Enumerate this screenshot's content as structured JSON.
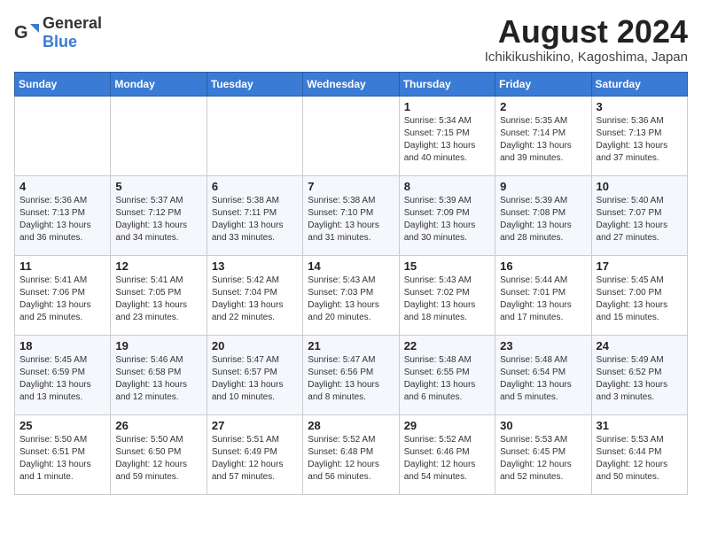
{
  "header": {
    "logo": {
      "text_general": "General",
      "text_blue": "Blue"
    },
    "month": "August 2024",
    "location": "Ichikikushikino, Kagoshima, Japan"
  },
  "days_of_week": [
    "Sunday",
    "Monday",
    "Tuesday",
    "Wednesday",
    "Thursday",
    "Friday",
    "Saturday"
  ],
  "weeks": [
    [
      {
        "day": "",
        "info": ""
      },
      {
        "day": "",
        "info": ""
      },
      {
        "day": "",
        "info": ""
      },
      {
        "day": "",
        "info": ""
      },
      {
        "day": "1",
        "info": "Sunrise: 5:34 AM\nSunset: 7:15 PM\nDaylight: 13 hours\nand 40 minutes."
      },
      {
        "day": "2",
        "info": "Sunrise: 5:35 AM\nSunset: 7:14 PM\nDaylight: 13 hours\nand 39 minutes."
      },
      {
        "day": "3",
        "info": "Sunrise: 5:36 AM\nSunset: 7:13 PM\nDaylight: 13 hours\nand 37 minutes."
      }
    ],
    [
      {
        "day": "4",
        "info": "Sunrise: 5:36 AM\nSunset: 7:13 PM\nDaylight: 13 hours\nand 36 minutes."
      },
      {
        "day": "5",
        "info": "Sunrise: 5:37 AM\nSunset: 7:12 PM\nDaylight: 13 hours\nand 34 minutes."
      },
      {
        "day": "6",
        "info": "Sunrise: 5:38 AM\nSunset: 7:11 PM\nDaylight: 13 hours\nand 33 minutes."
      },
      {
        "day": "7",
        "info": "Sunrise: 5:38 AM\nSunset: 7:10 PM\nDaylight: 13 hours\nand 31 minutes."
      },
      {
        "day": "8",
        "info": "Sunrise: 5:39 AM\nSunset: 7:09 PM\nDaylight: 13 hours\nand 30 minutes."
      },
      {
        "day": "9",
        "info": "Sunrise: 5:39 AM\nSunset: 7:08 PM\nDaylight: 13 hours\nand 28 minutes."
      },
      {
        "day": "10",
        "info": "Sunrise: 5:40 AM\nSunset: 7:07 PM\nDaylight: 13 hours\nand 27 minutes."
      }
    ],
    [
      {
        "day": "11",
        "info": "Sunrise: 5:41 AM\nSunset: 7:06 PM\nDaylight: 13 hours\nand 25 minutes."
      },
      {
        "day": "12",
        "info": "Sunrise: 5:41 AM\nSunset: 7:05 PM\nDaylight: 13 hours\nand 23 minutes."
      },
      {
        "day": "13",
        "info": "Sunrise: 5:42 AM\nSunset: 7:04 PM\nDaylight: 13 hours\nand 22 minutes."
      },
      {
        "day": "14",
        "info": "Sunrise: 5:43 AM\nSunset: 7:03 PM\nDaylight: 13 hours\nand 20 minutes."
      },
      {
        "day": "15",
        "info": "Sunrise: 5:43 AM\nSunset: 7:02 PM\nDaylight: 13 hours\nand 18 minutes."
      },
      {
        "day": "16",
        "info": "Sunrise: 5:44 AM\nSunset: 7:01 PM\nDaylight: 13 hours\nand 17 minutes."
      },
      {
        "day": "17",
        "info": "Sunrise: 5:45 AM\nSunset: 7:00 PM\nDaylight: 13 hours\nand 15 minutes."
      }
    ],
    [
      {
        "day": "18",
        "info": "Sunrise: 5:45 AM\nSunset: 6:59 PM\nDaylight: 13 hours\nand 13 minutes."
      },
      {
        "day": "19",
        "info": "Sunrise: 5:46 AM\nSunset: 6:58 PM\nDaylight: 13 hours\nand 12 minutes."
      },
      {
        "day": "20",
        "info": "Sunrise: 5:47 AM\nSunset: 6:57 PM\nDaylight: 13 hours\nand 10 minutes."
      },
      {
        "day": "21",
        "info": "Sunrise: 5:47 AM\nSunset: 6:56 PM\nDaylight: 13 hours\nand 8 minutes."
      },
      {
        "day": "22",
        "info": "Sunrise: 5:48 AM\nSunset: 6:55 PM\nDaylight: 13 hours\nand 6 minutes."
      },
      {
        "day": "23",
        "info": "Sunrise: 5:48 AM\nSunset: 6:54 PM\nDaylight: 13 hours\nand 5 minutes."
      },
      {
        "day": "24",
        "info": "Sunrise: 5:49 AM\nSunset: 6:52 PM\nDaylight: 13 hours\nand 3 minutes."
      }
    ],
    [
      {
        "day": "25",
        "info": "Sunrise: 5:50 AM\nSunset: 6:51 PM\nDaylight: 13 hours\nand 1 minute."
      },
      {
        "day": "26",
        "info": "Sunrise: 5:50 AM\nSunset: 6:50 PM\nDaylight: 12 hours\nand 59 minutes."
      },
      {
        "day": "27",
        "info": "Sunrise: 5:51 AM\nSunset: 6:49 PM\nDaylight: 12 hours\nand 57 minutes."
      },
      {
        "day": "28",
        "info": "Sunrise: 5:52 AM\nSunset: 6:48 PM\nDaylight: 12 hours\nand 56 minutes."
      },
      {
        "day": "29",
        "info": "Sunrise: 5:52 AM\nSunset: 6:46 PM\nDaylight: 12 hours\nand 54 minutes."
      },
      {
        "day": "30",
        "info": "Sunrise: 5:53 AM\nSunset: 6:45 PM\nDaylight: 12 hours\nand 52 minutes."
      },
      {
        "day": "31",
        "info": "Sunrise: 5:53 AM\nSunset: 6:44 PM\nDaylight: 12 hours\nand 50 minutes."
      }
    ]
  ]
}
